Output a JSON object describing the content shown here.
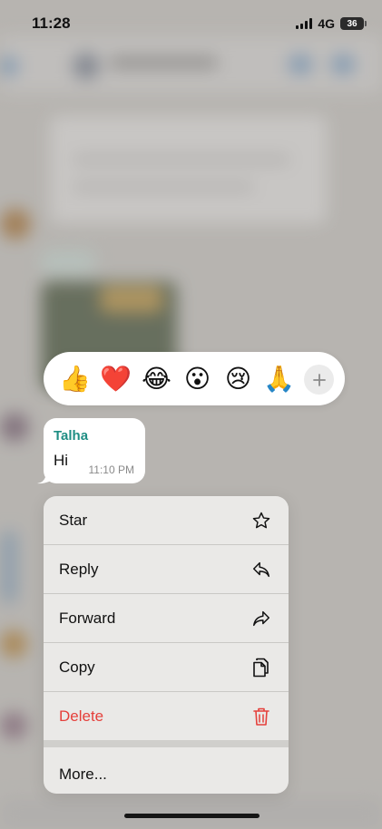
{
  "status_bar": {
    "time": "11:28",
    "network": "4G",
    "battery": "36"
  },
  "reactions": {
    "emojis": [
      {
        "glyph": "👍",
        "icon": "thumbs-up"
      },
      {
        "glyph": "❤️",
        "icon": "red-heart"
      },
      {
        "glyph": "😂",
        "icon": "tears-of-joy"
      },
      {
        "glyph": "😮",
        "icon": "face-open-mouth"
      },
      {
        "glyph": "😢",
        "icon": "crying-face"
      },
      {
        "glyph": "🙏",
        "icon": "folded-hands"
      }
    ],
    "more_icon": "plus-icon"
  },
  "message": {
    "sender": "Talha",
    "text": "Hi",
    "time": "11:10 PM"
  },
  "menu": {
    "items": [
      {
        "label": "Star",
        "icon": "star-icon"
      },
      {
        "label": "Reply",
        "icon": "reply-icon"
      },
      {
        "label": "Forward",
        "icon": "forward-icon"
      },
      {
        "label": "Copy",
        "icon": "copy-icon"
      },
      {
        "label": "Delete",
        "icon": "trash-icon"
      }
    ],
    "more_label": "More..."
  },
  "colors": {
    "sender": "#1f8e84",
    "delete": "#e5403b",
    "menu_bg": "#ecebe9"
  }
}
